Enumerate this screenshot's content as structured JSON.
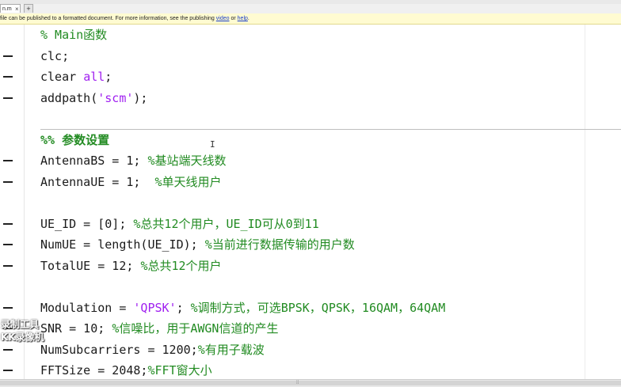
{
  "tabs": {
    "active_tab": "n.m",
    "close_glyph": "×",
    "add_glyph": "+"
  },
  "info_bar": {
    "text_before": "file can be published to a formatted document. For more information, see the publishing",
    "link1": "video",
    "middle": "or",
    "link2": "help",
    "end": "."
  },
  "code_lines": [
    {
      "parts": [
        {
          "t": "% Main函数",
          "c": "cm"
        }
      ],
      "dash": false
    },
    {
      "parts": [
        {
          "t": "clc;",
          "c": ""
        }
      ],
      "dash": true
    },
    {
      "parts": [
        {
          "t": "clear ",
          "c": ""
        },
        {
          "t": "all",
          "c": "str"
        },
        {
          "t": ";",
          "c": ""
        }
      ],
      "dash": true
    },
    {
      "parts": [
        {
          "t": "addpath(",
          "c": ""
        },
        {
          "t": "'scm'",
          "c": "str"
        },
        {
          "t": ");",
          "c": ""
        }
      ],
      "dash": true
    },
    {
      "parts": [],
      "dash": false
    },
    {
      "parts": [
        {
          "t": "%% 参数设置",
          "c": "cell-title"
        }
      ],
      "dash": false
    },
    {
      "parts": [
        {
          "t": "AntennaBS = 1; ",
          "c": ""
        },
        {
          "t": "%基站端天线数",
          "c": "cm"
        }
      ],
      "dash": true
    },
    {
      "parts": [
        {
          "t": "AntennaUE = 1;  ",
          "c": ""
        },
        {
          "t": "%单天线用户",
          "c": "cm"
        }
      ],
      "dash": true
    },
    {
      "parts": [],
      "dash": false
    },
    {
      "parts": [
        {
          "t": "UE_ID = [0]; ",
          "c": ""
        },
        {
          "t": "%总共12个用户，UE_ID可从0到11",
          "c": "cm"
        }
      ],
      "dash": true
    },
    {
      "parts": [
        {
          "t": "NumUE = length(UE_ID); ",
          "c": ""
        },
        {
          "t": "%当前进行数据传输的用户数",
          "c": "cm"
        }
      ],
      "dash": true
    },
    {
      "parts": [
        {
          "t": "TotalUE = 12; ",
          "c": ""
        },
        {
          "t": "%总共12个用户",
          "c": "cm"
        }
      ],
      "dash": true
    },
    {
      "parts": [],
      "dash": false
    },
    {
      "parts": [
        {
          "t": "Modulation = ",
          "c": ""
        },
        {
          "t": "'QPSK'",
          "c": "str"
        },
        {
          "t": "; ",
          "c": ""
        },
        {
          "t": "%调制方式，可选BPSK，QPSK，16QAM，64QAM",
          "c": "cm"
        }
      ],
      "dash": true
    },
    {
      "parts": [
        {
          "t": "SNR = 10; ",
          "c": ""
        },
        {
          "t": "%信噪比，用于AWGN信道的产生",
          "c": "cm"
        }
      ],
      "dash": true
    },
    {
      "parts": [
        {
          "t": "NumSubcarriers = 1200;",
          "c": ""
        },
        {
          "t": "%有用子载波",
          "c": "cm"
        }
      ],
      "dash": true
    },
    {
      "parts": [
        {
          "t": "FFTSize = 2048;",
          "c": ""
        },
        {
          "t": "%FFT窗大小",
          "c": "cm"
        }
      ],
      "dash": true
    }
  ],
  "cursor_glyph": "I",
  "watermark": {
    "line1": "录制工具",
    "line2": "KK录像机"
  },
  "scrollbar_grip": "⁞⁞"
}
